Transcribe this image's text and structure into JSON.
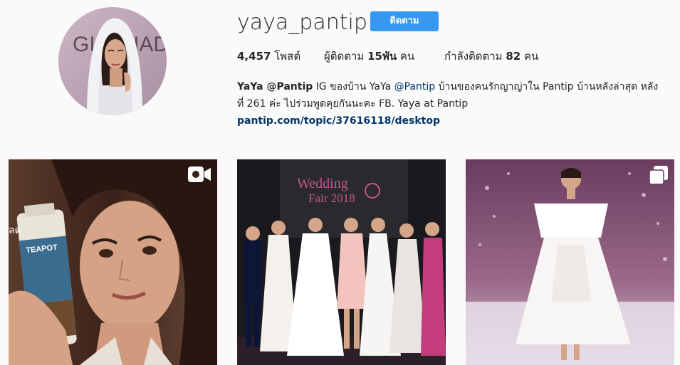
{
  "profile": {
    "username": "yaya_pantip",
    "follow_label": "ติดตาม",
    "avatar_backdrop_text": "GIGI HADID"
  },
  "stats": {
    "posts_count": "4,457",
    "posts_label": "โพสต์",
    "followers_label": "ผู้ติดตาม",
    "followers_count": "15พัน",
    "followers_unit": "คน",
    "following_label": "กำลังติดตาม",
    "following_count": "82",
    "following_unit": "คน"
  },
  "bio": {
    "name": "YaYa @Pantip",
    "text_1": " IG ของบ้าน YaYa ",
    "mention": "@Pantip",
    "text_2": " บ้านของคนรักญาญ่าใน Pantip บ้านหลังล่าสุด หลังที่ 261 ค่ะ ไปร่วมพูดคุยกันนะคะ FB. Yaya at Pantip",
    "link": "pantip.com/topic/37616118/desktop"
  },
  "posts": [
    {
      "type": "video",
      "icon": "video-camera-icon",
      "image_text": "TEAPOT",
      "edge_text": "ลด"
    },
    {
      "type": "image",
      "image_text_1": "Wedding",
      "image_text_2": "Fair 2018"
    },
    {
      "type": "carousel",
      "icon": "multiple-images-icon"
    }
  ],
  "colors": {
    "accent": "#3897f0",
    "link": "#003569",
    "background": "#fafafa"
  }
}
